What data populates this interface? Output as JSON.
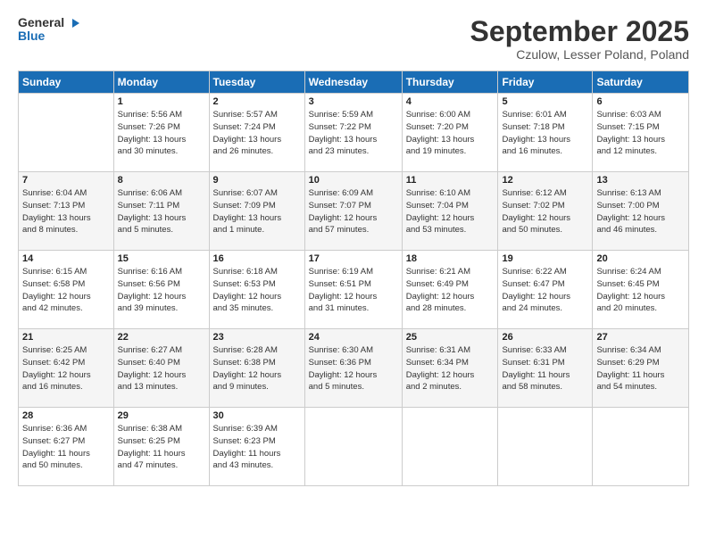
{
  "header": {
    "logo_line1": "General",
    "logo_line2": "Blue",
    "month": "September 2025",
    "location": "Czulow, Lesser Poland, Poland"
  },
  "weekdays": [
    "Sunday",
    "Monday",
    "Tuesday",
    "Wednesday",
    "Thursday",
    "Friday",
    "Saturday"
  ],
  "weeks": [
    [
      {
        "day": "",
        "info": ""
      },
      {
        "day": "1",
        "info": "Sunrise: 5:56 AM\nSunset: 7:26 PM\nDaylight: 13 hours\nand 30 minutes."
      },
      {
        "day": "2",
        "info": "Sunrise: 5:57 AM\nSunset: 7:24 PM\nDaylight: 13 hours\nand 26 minutes."
      },
      {
        "day": "3",
        "info": "Sunrise: 5:59 AM\nSunset: 7:22 PM\nDaylight: 13 hours\nand 23 minutes."
      },
      {
        "day": "4",
        "info": "Sunrise: 6:00 AM\nSunset: 7:20 PM\nDaylight: 13 hours\nand 19 minutes."
      },
      {
        "day": "5",
        "info": "Sunrise: 6:01 AM\nSunset: 7:18 PM\nDaylight: 13 hours\nand 16 minutes."
      },
      {
        "day": "6",
        "info": "Sunrise: 6:03 AM\nSunset: 7:15 PM\nDaylight: 13 hours\nand 12 minutes."
      }
    ],
    [
      {
        "day": "7",
        "info": "Sunrise: 6:04 AM\nSunset: 7:13 PM\nDaylight: 13 hours\nand 8 minutes."
      },
      {
        "day": "8",
        "info": "Sunrise: 6:06 AM\nSunset: 7:11 PM\nDaylight: 13 hours\nand 5 minutes."
      },
      {
        "day": "9",
        "info": "Sunrise: 6:07 AM\nSunset: 7:09 PM\nDaylight: 13 hours\nand 1 minute."
      },
      {
        "day": "10",
        "info": "Sunrise: 6:09 AM\nSunset: 7:07 PM\nDaylight: 12 hours\nand 57 minutes."
      },
      {
        "day": "11",
        "info": "Sunrise: 6:10 AM\nSunset: 7:04 PM\nDaylight: 12 hours\nand 53 minutes."
      },
      {
        "day": "12",
        "info": "Sunrise: 6:12 AM\nSunset: 7:02 PM\nDaylight: 12 hours\nand 50 minutes."
      },
      {
        "day": "13",
        "info": "Sunrise: 6:13 AM\nSunset: 7:00 PM\nDaylight: 12 hours\nand 46 minutes."
      }
    ],
    [
      {
        "day": "14",
        "info": "Sunrise: 6:15 AM\nSunset: 6:58 PM\nDaylight: 12 hours\nand 42 minutes."
      },
      {
        "day": "15",
        "info": "Sunrise: 6:16 AM\nSunset: 6:56 PM\nDaylight: 12 hours\nand 39 minutes."
      },
      {
        "day": "16",
        "info": "Sunrise: 6:18 AM\nSunset: 6:53 PM\nDaylight: 12 hours\nand 35 minutes."
      },
      {
        "day": "17",
        "info": "Sunrise: 6:19 AM\nSunset: 6:51 PM\nDaylight: 12 hours\nand 31 minutes."
      },
      {
        "day": "18",
        "info": "Sunrise: 6:21 AM\nSunset: 6:49 PM\nDaylight: 12 hours\nand 28 minutes."
      },
      {
        "day": "19",
        "info": "Sunrise: 6:22 AM\nSunset: 6:47 PM\nDaylight: 12 hours\nand 24 minutes."
      },
      {
        "day": "20",
        "info": "Sunrise: 6:24 AM\nSunset: 6:45 PM\nDaylight: 12 hours\nand 20 minutes."
      }
    ],
    [
      {
        "day": "21",
        "info": "Sunrise: 6:25 AM\nSunset: 6:42 PM\nDaylight: 12 hours\nand 16 minutes."
      },
      {
        "day": "22",
        "info": "Sunrise: 6:27 AM\nSunset: 6:40 PM\nDaylight: 12 hours\nand 13 minutes."
      },
      {
        "day": "23",
        "info": "Sunrise: 6:28 AM\nSunset: 6:38 PM\nDaylight: 12 hours\nand 9 minutes."
      },
      {
        "day": "24",
        "info": "Sunrise: 6:30 AM\nSunset: 6:36 PM\nDaylight: 12 hours\nand 5 minutes."
      },
      {
        "day": "25",
        "info": "Sunrise: 6:31 AM\nSunset: 6:34 PM\nDaylight: 12 hours\nand 2 minutes."
      },
      {
        "day": "26",
        "info": "Sunrise: 6:33 AM\nSunset: 6:31 PM\nDaylight: 11 hours\nand 58 minutes."
      },
      {
        "day": "27",
        "info": "Sunrise: 6:34 AM\nSunset: 6:29 PM\nDaylight: 11 hours\nand 54 minutes."
      }
    ],
    [
      {
        "day": "28",
        "info": "Sunrise: 6:36 AM\nSunset: 6:27 PM\nDaylight: 11 hours\nand 50 minutes."
      },
      {
        "day": "29",
        "info": "Sunrise: 6:38 AM\nSunset: 6:25 PM\nDaylight: 11 hours\nand 47 minutes."
      },
      {
        "day": "30",
        "info": "Sunrise: 6:39 AM\nSunset: 6:23 PM\nDaylight: 11 hours\nand 43 minutes."
      },
      {
        "day": "",
        "info": ""
      },
      {
        "day": "",
        "info": ""
      },
      {
        "day": "",
        "info": ""
      },
      {
        "day": "",
        "info": ""
      }
    ]
  ]
}
